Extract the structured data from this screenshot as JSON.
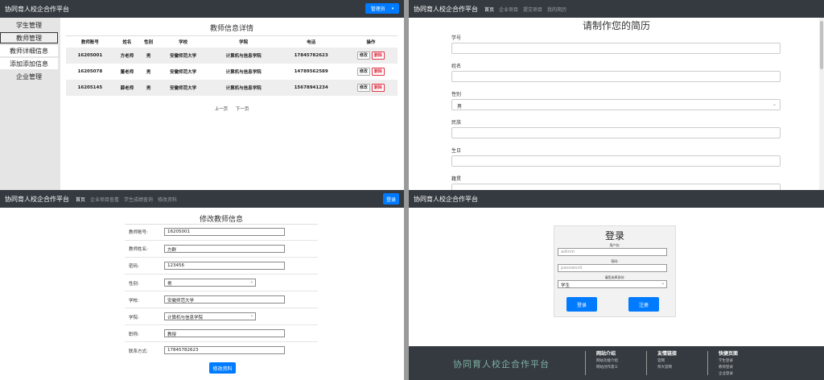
{
  "q1": {
    "brand": "协同育人校企合作平台",
    "admin_button": "管理员",
    "sidebar": [
      "学生管理",
      "教师管理",
      "教师详细信息",
      "添加添加信息",
      "企业管理"
    ],
    "title": "教师信息详情",
    "columns": [
      "教师账号",
      "姓名",
      "性别",
      "学校",
      "学院",
      "电话",
      "操作"
    ],
    "rows": [
      {
        "id": "16205001",
        "name": "方老师",
        "sex": "男",
        "school": "安徽师范大学",
        "college": "计算机与信息学院",
        "phone": "17845782623"
      },
      {
        "id": "16205078",
        "name": "董老师",
        "sex": "男",
        "school": "安徽师范大学",
        "college": "计算机与信息学院",
        "phone": "14789562589"
      },
      {
        "id": "16205145",
        "name": "薛老师",
        "sex": "男",
        "school": "安徽师范大学",
        "college": "计算机与信息学院",
        "phone": "15678941234"
      }
    ],
    "edit_label": "修改",
    "delete_label": "删除",
    "prev": "上一页",
    "next": "下一页"
  },
  "q2": {
    "brand": "协同育人校企合作平台",
    "nav": [
      "首页",
      "企业项目",
      "提交项目",
      "我的简历"
    ],
    "title": "请制作您的简历",
    "fields": [
      "学号",
      "姓名",
      "性别",
      "民族",
      "生日",
      "籍贯"
    ],
    "sex_value": "男"
  },
  "q3": {
    "brand": "协同育人校企合作平台",
    "nav": [
      "首页",
      "企业项目查看",
      "学生成绩查询",
      "修改资料"
    ],
    "login_button": "登录",
    "title": "修改教师信息",
    "labels": [
      "教师账号:",
      "教师姓名:",
      "密码:",
      "性别:",
      "学校:",
      "学院:",
      "职称:",
      "联系方式:"
    ],
    "values": [
      "16205001",
      "方群",
      "123456",
      "男",
      "安徽师范大学",
      "计算机与信息学院",
      "教授",
      "17845782623"
    ],
    "submit": "修改资料"
  },
  "q4": {
    "brand": "协同育人校企合作平台",
    "login_title": "登录",
    "username_label": "用户名:",
    "username_placeholder": "admin",
    "password_label": "密码:",
    "password_placeholder": "password",
    "role_label": "请您选择身份:",
    "role_value": "学生",
    "login_button": "登录",
    "register_button": "注册",
    "footer_brand": "协同育人校企合作平台",
    "footer_cols": [
      {
        "head": "网站介绍",
        "items": [
          "网站功能介绍",
          "网站创作意义"
        ]
      },
      {
        "head": "友情链接",
        "items": [
          "官网",
          "师大官网"
        ]
      },
      {
        "head": "快捷页面",
        "items": [
          "学生登录",
          "教师登录",
          "企业登录"
        ]
      }
    ]
  }
}
